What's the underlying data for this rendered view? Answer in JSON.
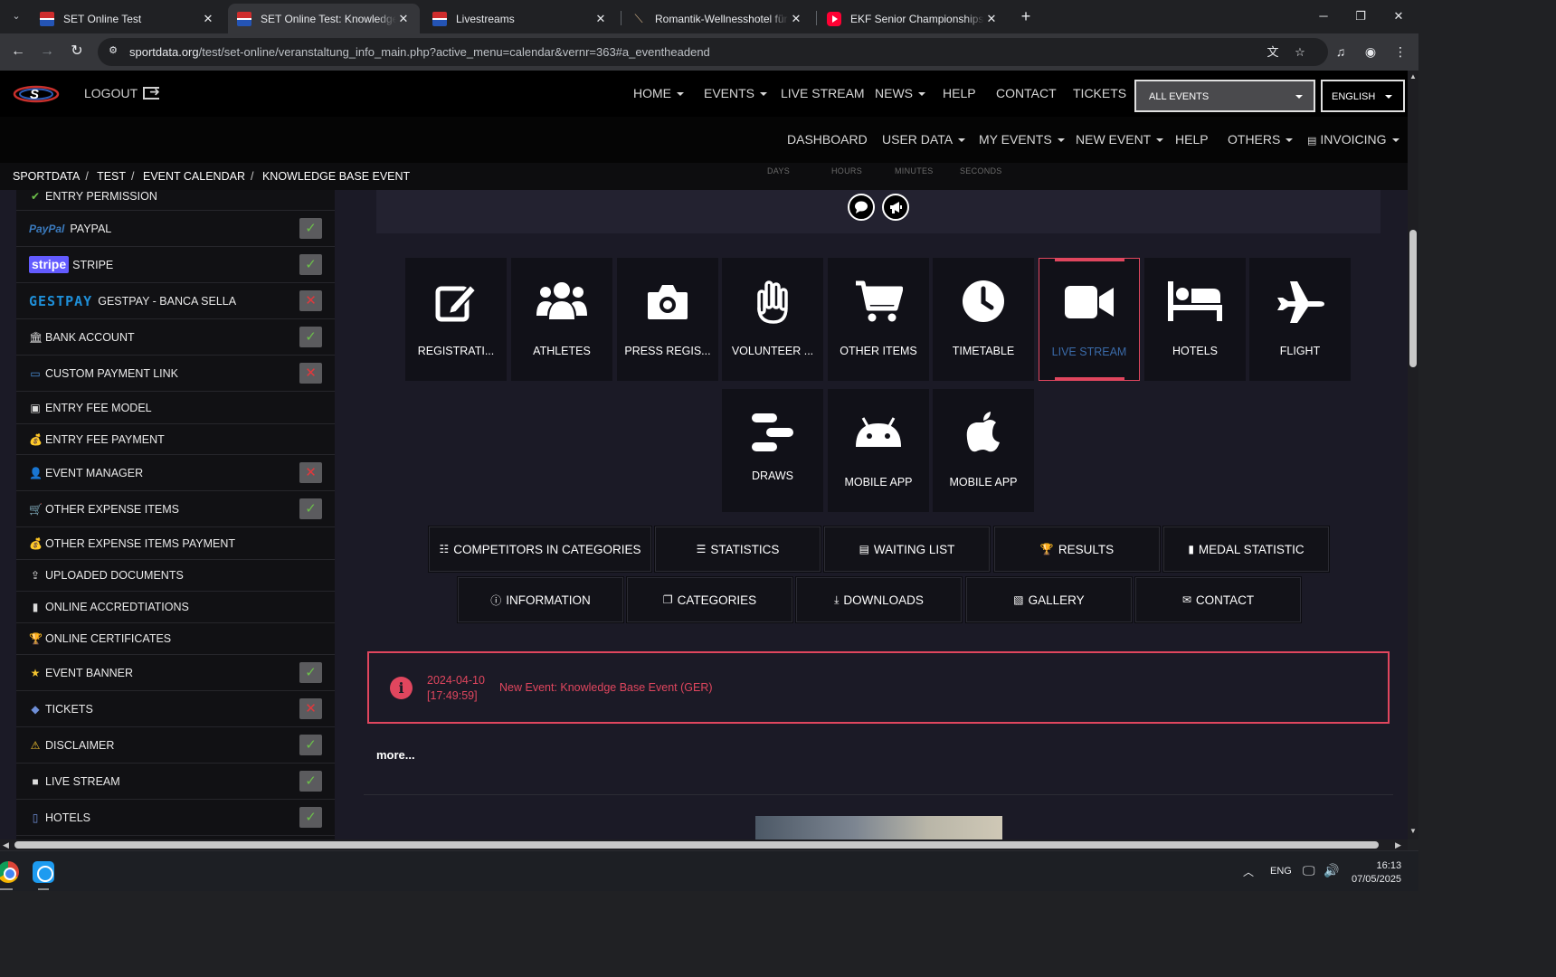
{
  "browser": {
    "tabs": [
      {
        "title": "SET Online Test",
        "favicon": "sportdata-favicon",
        "active": false
      },
      {
        "title": "SET Online Test: Knowledge Base Event",
        "favicon": "sportdata-favicon",
        "active": true
      },
      {
        "title": "Livestreams",
        "favicon": "sportdata-favicon",
        "active": false
      },
      {
        "title": "Romantik-Wellnesshotel für Paare",
        "favicon": "hotel-favicon",
        "active": false
      },
      {
        "title": "EKF Senior Championships | Day",
        "favicon": "youtube-favicon",
        "active": false
      }
    ],
    "url_host": "sportdata.org",
    "url_path": "/test/set-online/veranstaltung_info_main.php?active_menu=calendar&vernr=363#a_eventheadend"
  },
  "topnav": {
    "logout": "LOGOUT",
    "items": [
      "HOME",
      "EVENTS",
      "LIVE STREAM",
      "NEWS",
      "HELP",
      "CONTACT",
      "TICKETS"
    ],
    "events_select": "ALL EVENTS",
    "language_select": "ENGLISH"
  },
  "subnav": {
    "items": [
      "DASHBOARD",
      "USER DATA",
      "MY EVENTS",
      "NEW EVENT",
      "HELP",
      "OTHERS",
      "INVOICING"
    ]
  },
  "breadcrumb": [
    "SPORTDATA",
    "TEST",
    "EVENT CALENDAR",
    "KNOWLEDGE BASE EVENT"
  ],
  "countdown_labels": [
    "DAYS",
    "HOURS",
    "MINUTES",
    "SECONDS"
  ],
  "left_panel": {
    "items": [
      {
        "label": "ENTRY PERMISSION",
        "icon": "check-icon",
        "status": null
      },
      {
        "label": "PAYPAL",
        "icon": "paypal-logo",
        "logo_text": "PayPal",
        "status": "ok"
      },
      {
        "label": "STRIPE",
        "icon": "stripe-logo",
        "logo_text": "stripe",
        "status": "ok"
      },
      {
        "label": "GESTPAY - BANCA SELLA",
        "icon": "gestpay-logo",
        "logo_text": "GESTPAY",
        "status": "no"
      },
      {
        "label": "BANK ACCOUNT",
        "icon": "bank-icon",
        "status": "ok"
      },
      {
        "label": "CUSTOM PAYMENT LINK",
        "icon": "card-icon",
        "status": "no"
      },
      {
        "label": "ENTRY FEE MODEL",
        "icon": "money-icon",
        "status": null
      },
      {
        "label": "ENTRY FEE PAYMENT",
        "icon": "money-bag-icon",
        "status": null
      },
      {
        "label": "EVENT MANAGER",
        "icon": "user-icon",
        "status": "no"
      },
      {
        "label": "OTHER EXPENSE ITEMS",
        "icon": "cart-icon",
        "status": "ok"
      },
      {
        "label": "OTHER EXPENSE ITEMS PAYMENT",
        "icon": "money-bag-icon",
        "status": null
      },
      {
        "label": "UPLOADED DOCUMENTS",
        "icon": "upload-icon",
        "status": null
      },
      {
        "label": "ONLINE ACCREDTIATIONS",
        "icon": "id-badge-icon",
        "status": null
      },
      {
        "label": "ONLINE CERTIFICATES",
        "icon": "trophy-icon",
        "status": null
      },
      {
        "label": "EVENT BANNER",
        "icon": "star-icon",
        "status": "ok"
      },
      {
        "label": "TICKETS",
        "icon": "ticket-icon",
        "status": "no"
      },
      {
        "label": "DISCLAIMER",
        "icon": "warning-icon",
        "status": "ok"
      },
      {
        "label": "LIVE STREAM",
        "icon": "video-icon",
        "status": "ok"
      },
      {
        "label": "HOTELS",
        "icon": "hotel-icon",
        "status": "ok"
      }
    ]
  },
  "tiles": [
    {
      "label": "REGISTRATI...",
      "icon": "edit-icon",
      "active": false
    },
    {
      "label": "ATHLETES",
      "icon": "users-icon",
      "active": false
    },
    {
      "label": "PRESS REGIS...",
      "icon": "camera-icon",
      "active": false
    },
    {
      "label": "VOLUNTEER ...",
      "icon": "hand-icon",
      "active": false
    },
    {
      "label": "OTHER ITEMS",
      "icon": "cart-icon",
      "active": false
    },
    {
      "label": "TIMETABLE",
      "icon": "clock-icon",
      "active": false
    },
    {
      "label": "LIVE STREAM",
      "icon": "video-icon",
      "active": true
    },
    {
      "label": "HOTELS",
      "icon": "bed-icon",
      "active": false
    },
    {
      "label": "FLIGHT",
      "icon": "plane-icon",
      "active": false
    },
    {
      "label": "DRAWS",
      "icon": "draws-icon",
      "active": false
    },
    {
      "label": "MOBILE APP",
      "icon": "android-icon",
      "active": false
    },
    {
      "label": "MOBILE APP",
      "icon": "apple-icon",
      "active": false
    }
  ],
  "buttons_row1": [
    {
      "label": "COMPETITORS IN CATEGORIES",
      "icon": "list-check-icon"
    },
    {
      "label": "STATISTICS",
      "icon": "list-icon"
    },
    {
      "label": "WAITING LIST",
      "icon": "clipboard-icon"
    },
    {
      "label": "RESULTS",
      "icon": "trophy-icon"
    },
    {
      "label": "MEDAL STATISTIC",
      "icon": "bar-chart-icon"
    }
  ],
  "buttons_row2": [
    {
      "label": "INFORMATION",
      "icon": "info-icon"
    },
    {
      "label": "CATEGORIES",
      "icon": "copy-icon"
    },
    {
      "label": "DOWNLOADS",
      "icon": "download-icon"
    },
    {
      "label": "GALLERY",
      "icon": "image-icon"
    },
    {
      "label": "CONTACT",
      "icon": "envelope-icon"
    }
  ],
  "news": {
    "date": "2024-04-10",
    "time": "[17:49:59]",
    "text": "New Event: Knowledge Base Event (GER)",
    "more": "more..."
  },
  "taskbar": {
    "lang": "ENG",
    "time": "16:13",
    "date": "07/05/2025"
  },
  "colors": {
    "accent": "#e0465e",
    "page_bg": "#1b1a26",
    "tile_bg": "#111118",
    "ok": "#6cc04a",
    "no": "#e2383c"
  }
}
